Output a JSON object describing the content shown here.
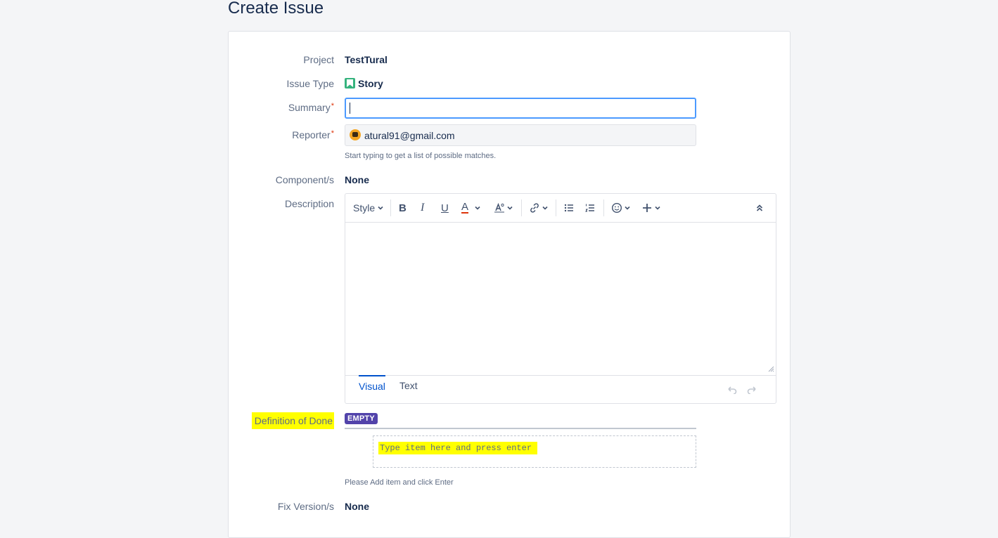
{
  "page": {
    "title": "Create Issue"
  },
  "form": {
    "project": {
      "label": "Project",
      "value": "TestTural"
    },
    "issue_type": {
      "label": "Issue Type",
      "value": "Story",
      "icon": "story-icon",
      "icon_color": "#36b37e"
    },
    "summary": {
      "label": "Summary",
      "required_mark": "*",
      "value": ""
    },
    "reporter": {
      "label": "Reporter",
      "required_mark": "*",
      "value": "atural91@gmail.com",
      "hint": "Start typing to get a list of possible matches."
    },
    "components": {
      "label": "Component/s",
      "value": "None"
    },
    "description": {
      "label": "Description",
      "toolbar": {
        "style_label": "Style"
      },
      "tabs": [
        {
          "label": "Visual"
        },
        {
          "label": "Text"
        }
      ]
    },
    "definition_of_done": {
      "label": "Definition of Done",
      "badge": "EMPTY",
      "badge_color": "#5243aa",
      "placeholder": "Type item here and press enter",
      "hint": "Please Add item and click Enter"
    },
    "fix_versions": {
      "label": "Fix Version/s",
      "value": "None"
    }
  },
  "colors": {
    "accent": "#0052cc",
    "focus": "#4c9aff",
    "required": "#de350b",
    "highlight": "#ffff00"
  }
}
